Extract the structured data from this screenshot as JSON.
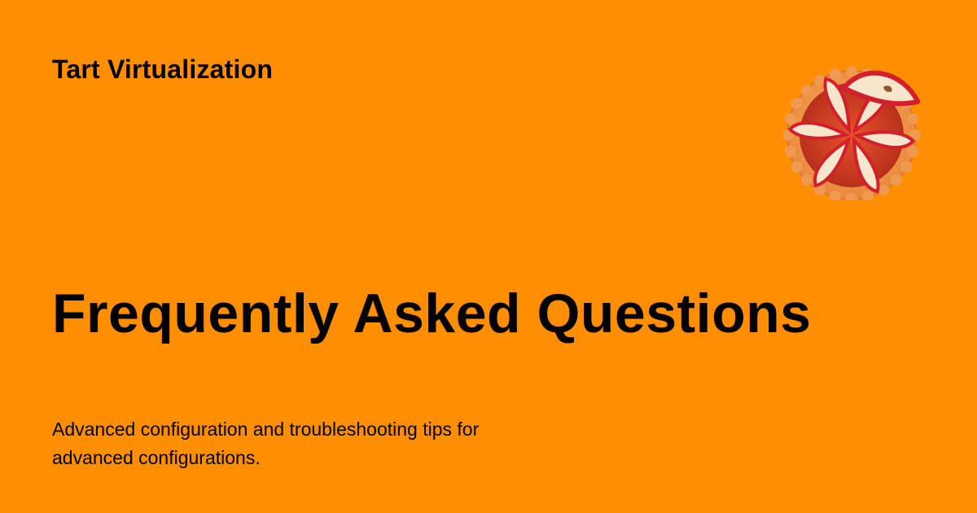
{
  "header": {
    "site_name": "Tart Virtualization",
    "logo_icon": "apple-tart-icon"
  },
  "main": {
    "title": "Frequently Asked Questions",
    "description": "Advanced configuration and troubleshooting tips for advanced configurations."
  },
  "colors": {
    "background": "#FF8F00",
    "text": "#000000",
    "tart_crust": "#F49A4C",
    "tart_filling": "#C7351C",
    "apple_skin": "#D2202A",
    "apple_flesh": "#F8E6CC"
  }
}
